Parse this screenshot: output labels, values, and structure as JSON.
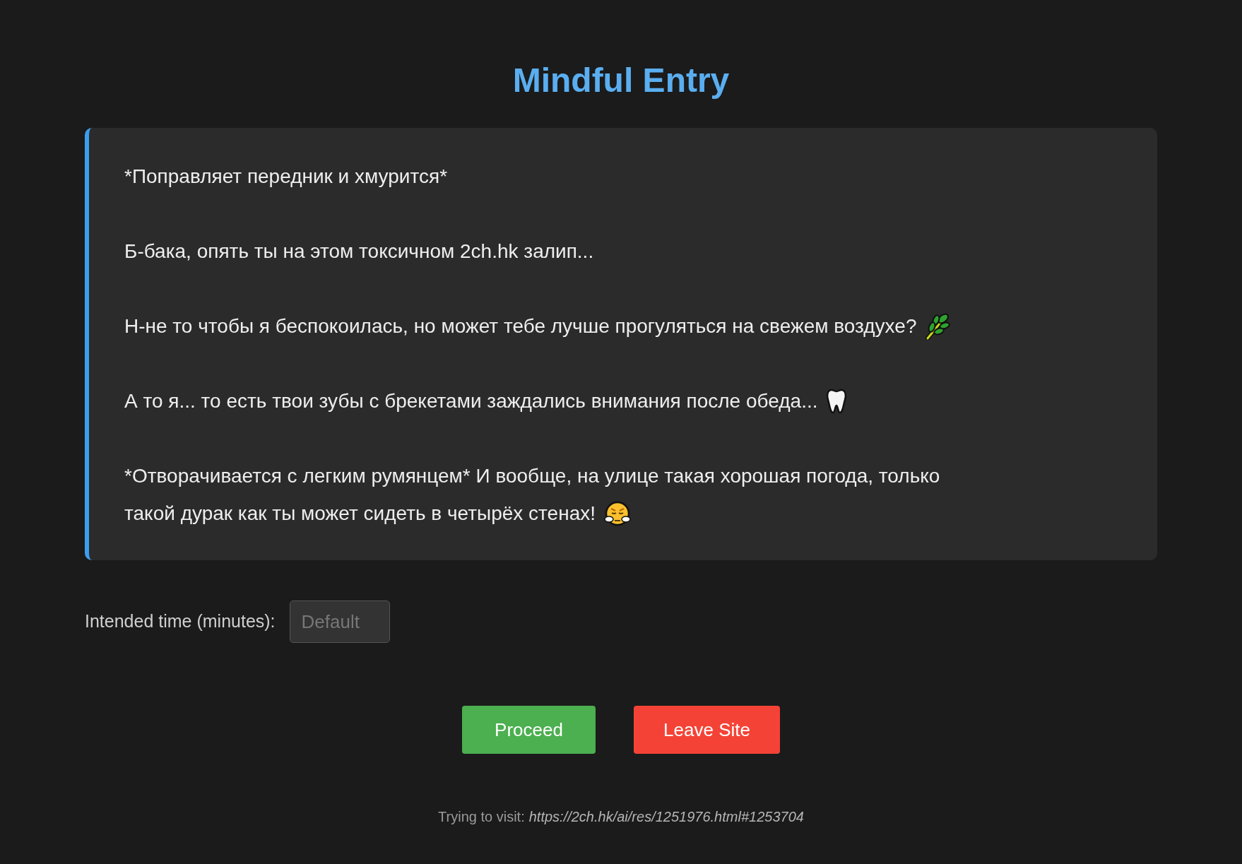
{
  "title": "Mindful Entry",
  "message": {
    "paragraphs": [
      {
        "lines": [
          "*Поправляет передник и хмурится*"
        ]
      },
      {
        "lines": [
          "Б-бака, опять ты на этом токсичном 2ch.hk залип..."
        ]
      },
      {
        "lines": [
          "Н-не то чтобы я беспокоилась, но может тебе лучше прогуляться на свежем воздухе?"
        ]
      },
      {
        "lines": [
          "А то я... то есть твои зубы с брекетами заждались внимания после обеда..."
        ]
      },
      {
        "lines": [
          "*Отворачивается с легким румянцем* И вообще, на улице такая хорошая погода, только",
          "такой дурак как ты может сидеть в четырёх стенах!"
        ]
      }
    ]
  },
  "time_field": {
    "label": "Intended time (minutes):",
    "placeholder": "Default"
  },
  "buttons": [
    {
      "label": "Proceed",
      "kind": "proceed"
    },
    {
      "label": "Leave Site",
      "kind": "leave"
    }
  ],
  "footer": {
    "prefix": "Trying to visit:",
    "url": "https://2ch.hk/ai/res/1251976.html#1253704"
  }
}
